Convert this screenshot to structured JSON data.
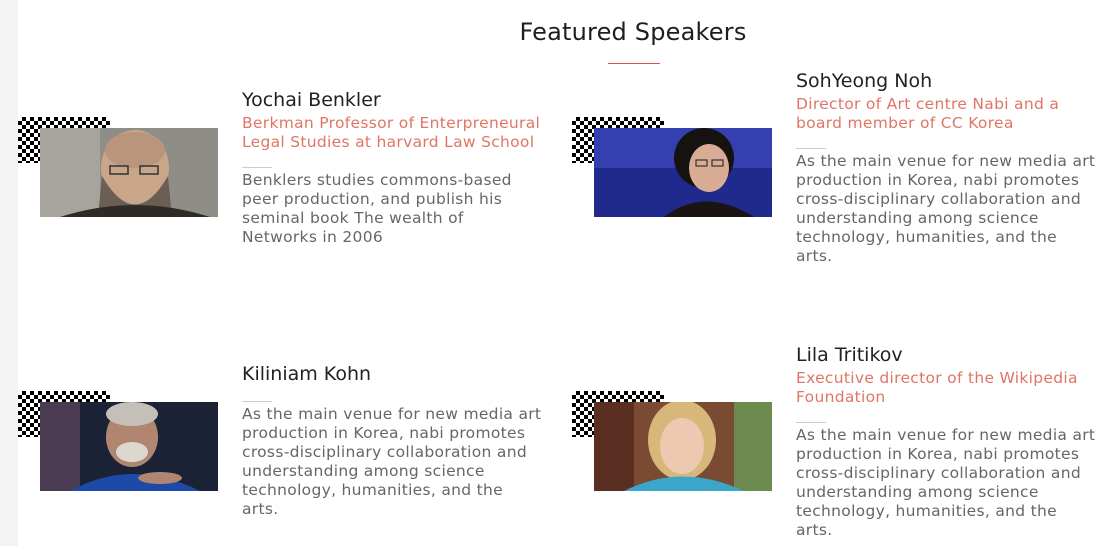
{
  "section": {
    "title": "Featured Speakers"
  },
  "speakers": [
    {
      "name": "Yochai Benkler",
      "role": "Berkman Professor of Enterpreneural Legal Studies at harvard Law School",
      "bio": "Benklers studies commons-based peer production, and publish his seminal book The wealth of Networks in 2006"
    },
    {
      "name": "SohYeong Noh",
      "role": "Director of Art centre Nabi and a board member of CC Korea",
      "bio": "As the main venue for new media art production in Korea, nabi promotes cross-disciplinary collaboration and understanding among science technology, humanities, and the arts."
    },
    {
      "name": "Kiliniam Kohn",
      "role": "",
      "bio": "As the main venue for new media art production in Korea, nabi promotes cross-disciplinary collaboration and understanding among science technology, humanities, and the arts."
    },
    {
      "name": "Lila Tritikov",
      "role": "Executive director of the Wikipedia Foundation",
      "bio": "As the main venue for new media art production in Korea, nabi promotes cross-disciplinary collaboration and understanding among science technology, humanities, and the arts."
    }
  ],
  "colors": {
    "accent": "#e07565",
    "title_rule": "#d9534f",
    "body_text": "#666666"
  }
}
